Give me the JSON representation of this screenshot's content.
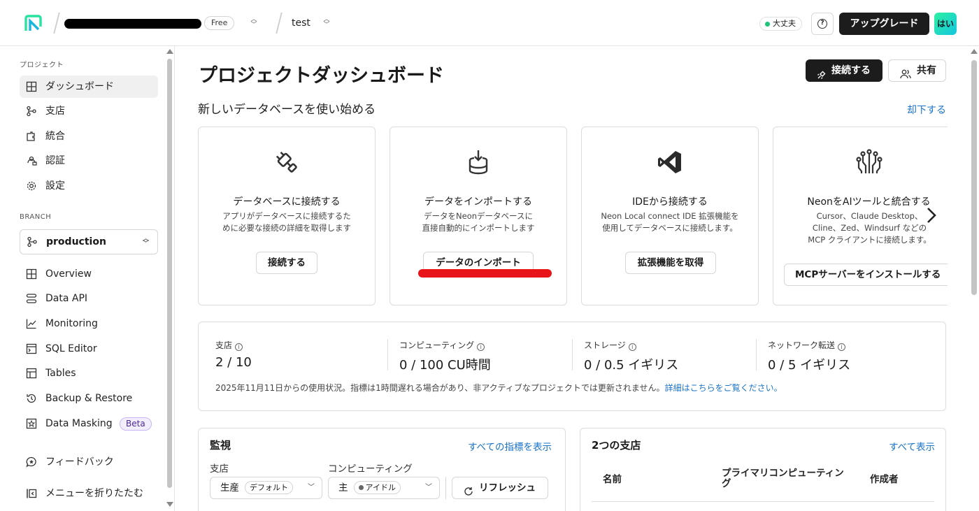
{
  "header": {
    "plan_badge": "Free",
    "project_name": "test",
    "status_label": "大丈夫",
    "help_label": "?",
    "upgrade_label": "アップグレード",
    "avatar_label": "はい"
  },
  "sidebar": {
    "project_section": "プロジェクト",
    "project_items": [
      {
        "label": "ダッシュボード",
        "icon": "dashboard-icon"
      },
      {
        "label": "支店",
        "icon": "branch-icon"
      },
      {
        "label": "統合",
        "icon": "integration-icon"
      },
      {
        "label": "認証",
        "icon": "auth-icon"
      },
      {
        "label": "設定",
        "icon": "gear-icon"
      }
    ],
    "branch_section": "BRANCH",
    "branch_selected": "production",
    "branch_items": [
      {
        "label": "Overview",
        "icon": "grid-icon"
      },
      {
        "label": "Data API",
        "icon": "api-icon"
      },
      {
        "label": "Monitoring",
        "icon": "chart-icon"
      },
      {
        "label": "SQL Editor",
        "icon": "terminal-icon"
      },
      {
        "label": "Tables",
        "icon": "table-icon"
      },
      {
        "label": "Backup & Restore",
        "icon": "history-icon"
      },
      {
        "label": "Data Masking",
        "icon": "mask-icon"
      }
    ],
    "beta_badge": "Beta",
    "feedback_label": "フィードバック",
    "collapse_label": "メニューを折りたたむ"
  },
  "main": {
    "title": "プロジェクトダッシュボード",
    "connect_label": "接続する",
    "share_label": "共有",
    "subtitle": "新しいデータベースを使い始める",
    "dismiss_label": "却下する",
    "cards": [
      {
        "title": "データベースに接続する",
        "desc_1": "アプリがデータベースに接続するた",
        "desc_2": "めに必要な接続の詳細を取得します",
        "desc_3": "",
        "button": "接続する",
        "icon": "plug-icon"
      },
      {
        "title": "データをインポートする",
        "desc_1": "データをNeonデータベースに",
        "desc_2": "直接自動的にインポートします",
        "desc_3": "",
        "button": "データのインポート",
        "icon": "database-import-icon"
      },
      {
        "title": "IDEから接続する",
        "desc_1": "Neon Local connect IDE 拡張機能を",
        "desc_2": "使用してデータベースに接続します。",
        "desc_3": "",
        "button": "拡張機能を取得",
        "icon": "vscode-icon"
      },
      {
        "title": "NeonをAIツールと統合する",
        "desc_1": "Cursor、Claude Desktop、",
        "desc_2": "Cline、Zed、Windsurf などの",
        "desc_3": "MCP クライアントに接続します。",
        "button": "MCPサーバーをインストールする",
        "icon": "ai-circuit-icon"
      }
    ],
    "usage": [
      {
        "label": "支店",
        "value": "2 / 10"
      },
      {
        "label": "コンピューティング",
        "value": "0 / 100 CU時間"
      },
      {
        "label": "ストレージ",
        "value": "0 / 0.5 イギリス"
      },
      {
        "label": "ネットワーク転送",
        "value": "0 / 5 イギリス"
      }
    ],
    "usage_note": "2025年11月11日からの使用状況。指標は1時間遅れる場合があり、非アクティブなプロジェクトでは更新されません。",
    "usage_note_link": "詳細はこちらをご覧ください。",
    "monitor": {
      "title": "監視",
      "link": "すべての指標を表示",
      "branch_label": "支店",
      "compute_label": "コンピューティング",
      "branch_value": "生産",
      "branch_chip": "デフォルト",
      "compute_value": "主",
      "compute_chip": "アイドル",
      "refresh_label": "リフレッシュ"
    },
    "branches": {
      "title": "2つの支店",
      "link": "すべて表示",
      "col_name": "名前",
      "col_compute_1": "プライマリコンピューティン",
      "col_compute_2": "グ",
      "col_creator": "作成者"
    }
  }
}
